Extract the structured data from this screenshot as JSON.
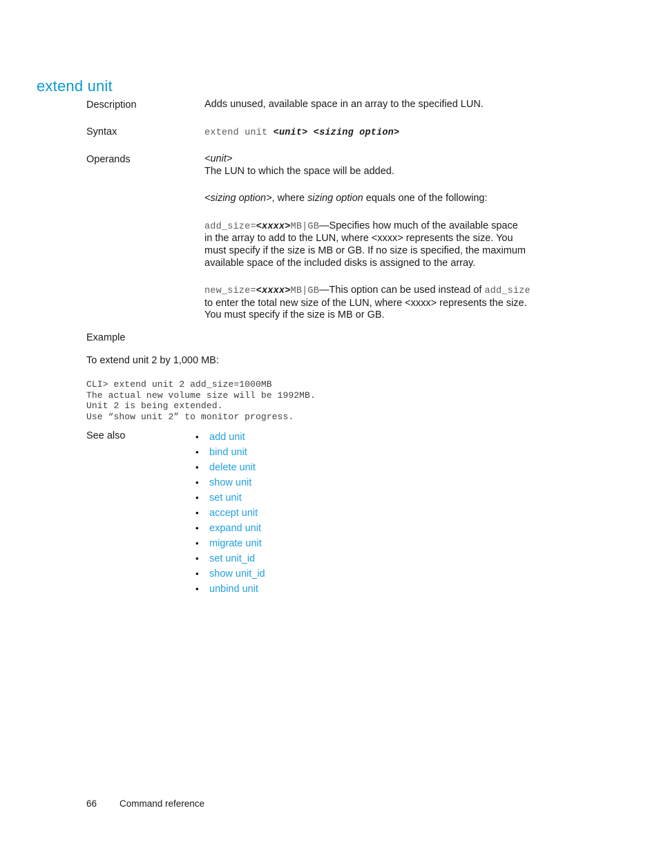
{
  "document": {
    "heading": "extend unit",
    "heading_color": "#0d98d4",
    "link_color": "#21a0dd",
    "background_color": "#ffffff",
    "text_color": "#1a1a1a"
  },
  "labels": {
    "description": "Description",
    "syntax": "Syntax",
    "operands": "Operands",
    "see_also": "See also"
  },
  "description": {
    "text": "Adds unused, available space in an array to the specified LUN."
  },
  "syntax": {
    "command": "extend unit",
    "arg_unit": "<unit>",
    "arg_sizing_option": "<sizing option>"
  },
  "operands": {
    "unit_placeholder": "<unit>",
    "unit_text": "The LUN to which the space will be added.",
    "sizing_intro_prefix": "<sizing option>",
    "sizing_intro_mid": ", where ",
    "sizing_intro_italic": "sizing option",
    "sizing_intro_suffix": " equals one of the following:",
    "add_size": {
      "code_name": "add_size=",
      "code_placeholder": "<xxxx>",
      "code_units": "MB|GB",
      "dash": "—",
      "text_1": "Specifies how much of the available space",
      "text_2": "in the array to add to the LUN, where <xxxx> represents the size.  You",
      "text_3": "must specify if the size is MB or GB. If no size is specified, the maximum",
      "text_4": "available space of the included disks is assigned to the array."
    },
    "new_size": {
      "code_name": "new_size=",
      "code_placeholder": "<xxxx>",
      "code_units": "MB|GB",
      "dash": "—",
      "text_1a": "This option can be used instead of ",
      "text_1b_code": "add_size",
      "text_2": "to enter the total new size of the LUN, where <xxxx> represents the size.",
      "text_3": "You must specify if the size is MB or GB."
    }
  },
  "example": {
    "title": "Example",
    "subtitle": "To extend unit 2 by 1,000 MB:",
    "code": "CLI> extend unit 2 add_size=1000MB\nThe actual new volume size will be 1992MB.\nUnit 2 is being extended.\nUse “show unit 2” to monitor progress."
  },
  "see_also": {
    "bullet": "•",
    "items": [
      {
        "label": "add unit"
      },
      {
        "label": "bind unit"
      },
      {
        "label": "delete unit"
      },
      {
        "label": "show unit"
      },
      {
        "label": "set unit"
      },
      {
        "label": "accept unit"
      },
      {
        "label": "expand unit"
      },
      {
        "label": "migrate unit"
      },
      {
        "label": "set unit_id"
      },
      {
        "label": "show unit_id"
      },
      {
        "label": "unbind unit"
      }
    ]
  },
  "footer": {
    "page_number": "66",
    "section_title": "Command reference"
  }
}
